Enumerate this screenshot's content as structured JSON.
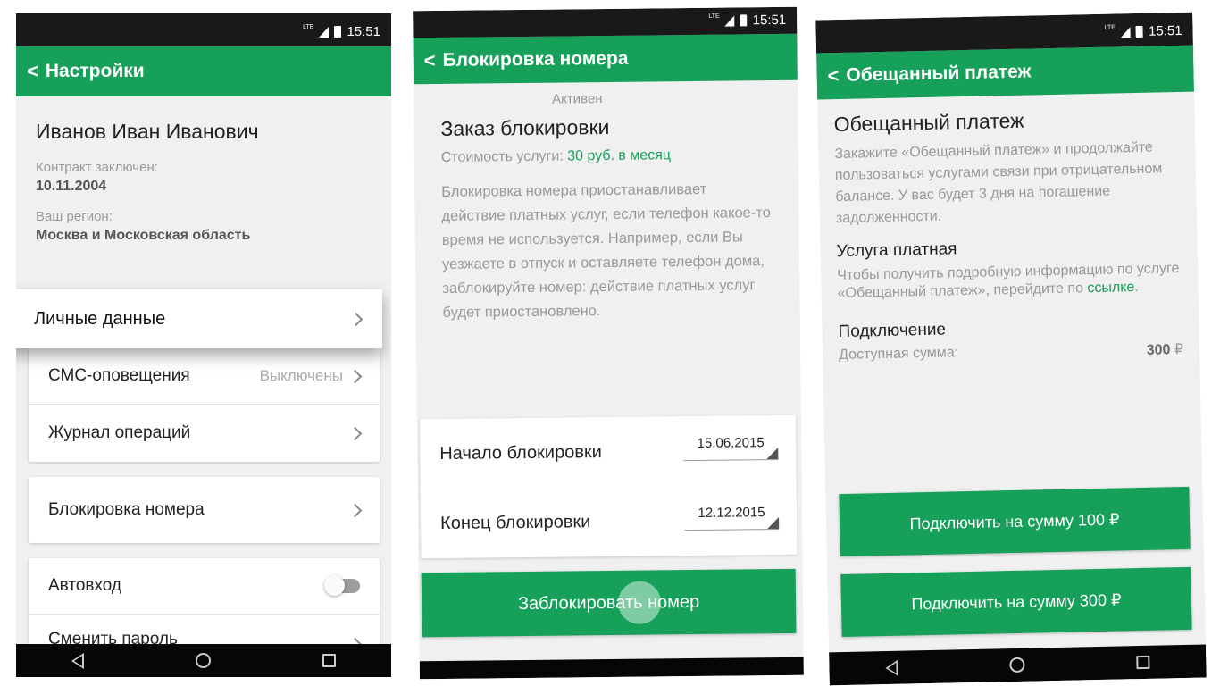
{
  "status": {
    "lte": "LTE",
    "time": "15:51"
  },
  "screen1": {
    "title": "Настройки",
    "name": "Иванов Иван Иванович",
    "contract_label": "Контракт заключен:",
    "contract_date": "10.11.2004",
    "region_label": "Ваш регион:",
    "region_value": "Москва и Московская область",
    "personal_data": "Личные данные",
    "sms_label": "СМС-оповещения",
    "sms_value": "Выключены",
    "journal": "Журнал операций",
    "block_number": "Блокировка номера",
    "autologin": "Автовход",
    "change_password": "Сменить пароль"
  },
  "screen2": {
    "title": "Блокировка номера",
    "peek_status": "Активен",
    "order_title": "Заказ блокировки",
    "cost_label": "Стоимость услуги:",
    "cost_value": "30 руб. в месяц",
    "description": "Блокировка номера приостанавливает действие платных услуг, если телефон какое-то время не используется. Например, если Вы уезжаете в отпуск и оставляете телефон дома, заблокируйте номер: действие платных услуг будет приостановлено.",
    "start_label": "Начало блокировки",
    "start_value": "15.06.2015",
    "end_label": "Конец блокировки",
    "end_value": "12.12.2015",
    "block_button": "Заблокировать номер"
  },
  "screen3": {
    "title": "Обещанный платеж",
    "heading": "Обещанный платеж",
    "text1": "Закажите «Обещанный платеж» и продолжайте пользоваться услугами связи при отрицательном балансе. У вас будет 3 дня на погашение задолженности.",
    "paid_heading": "Услуга платная",
    "paid_text": "Чтобы получить подробную информацию по услуге «Обещанный платеж», перейдите по",
    "link_text": "ссылке",
    "connect_heading": "Подключение",
    "available_label": "Доступная сумма:",
    "available_value": "300",
    "currency": "₽",
    "btn100": "Подключить на сумму 100 ₽",
    "btn300": "Подключить на сумму 300 ₽"
  }
}
